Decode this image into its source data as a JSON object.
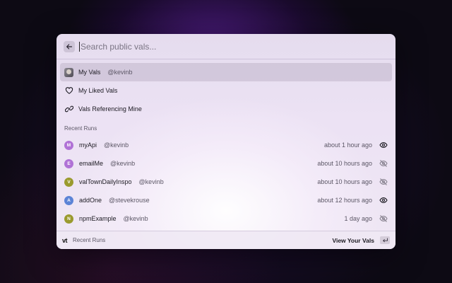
{
  "search": {
    "placeholder": "Search public vals..."
  },
  "menu": [
    {
      "label": "My Vals",
      "handle": "@kevinb",
      "icon": "user-avatar",
      "active": true
    },
    {
      "label": "My Liked Vals",
      "icon": "heart-icon"
    },
    {
      "label": "Vals Referencing Mine",
      "icon": "link-icon"
    }
  ],
  "recent": {
    "section_label": "Recent Runs",
    "runs": [
      {
        "initial": "M",
        "name": "myApi",
        "handle": "@kevinb",
        "time": "about 1 hour ago",
        "color": "#b072d6",
        "visibility": "eye-icon"
      },
      {
        "initial": "E",
        "name": "emailMe",
        "handle": "@kevinb",
        "time": "about 10 hours ago",
        "color": "#b072d6",
        "visibility": "eye-off-icon"
      },
      {
        "initial": "V",
        "name": "valTownDailyInspo",
        "handle": "@kevinb",
        "time": "about 10 hours ago",
        "color": "#9a9a2e",
        "visibility": "eye-off-icon"
      },
      {
        "initial": "A",
        "name": "addOne",
        "handle": "@stevekrouse",
        "time": "about 12 hours ago",
        "color": "#5c84d6",
        "visibility": "eye-icon"
      },
      {
        "initial": "N",
        "name": "npmExample",
        "handle": "@kevinb",
        "time": "1 day ago",
        "color": "#9a9a2e",
        "visibility": "eye-off-icon"
      }
    ]
  },
  "footer": {
    "logo": "vt",
    "label": "Recent Runs",
    "action": "View Your Vals"
  }
}
